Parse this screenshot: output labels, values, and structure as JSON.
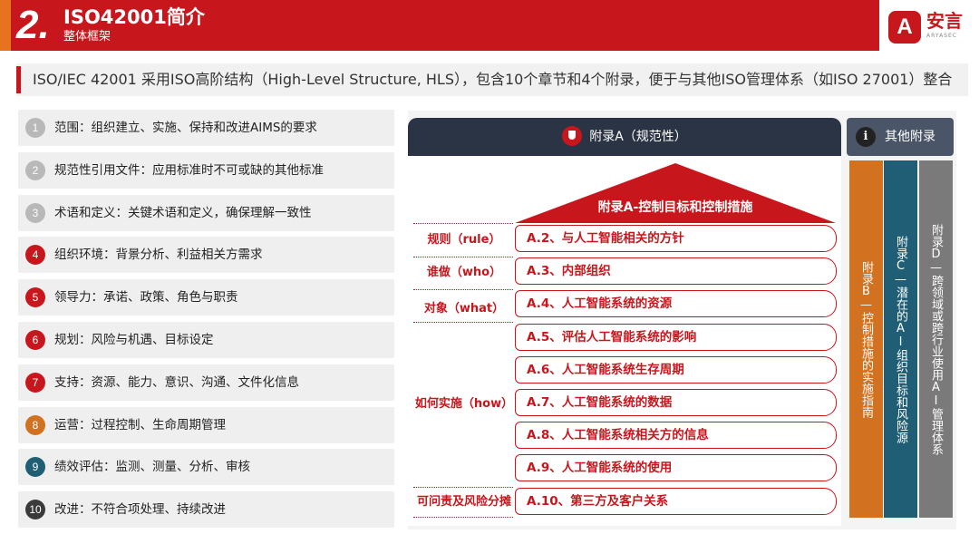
{
  "header": {
    "number": "2.",
    "title": "ISO42001简介",
    "subtitle": "整体框架"
  },
  "logo": {
    "mark": "A",
    "name": "安言",
    "en": "ARYASEC"
  },
  "intro": "ISO/IEC 42001 采用ISO高阶结构（High-Level Structure, HLS），包含10个章节和4个附录，便于与其他ISO管理体系（如ISO 27001）整合",
  "chapters": [
    {
      "num": "1",
      "label": "范围：组织建立、实施、保持和改进AIMS的要求",
      "color": "#b8b8b8"
    },
    {
      "num": "2",
      "label": "规范性引用文件：应用标准时不可或缺的其他标准",
      "color": "#b8b8b8"
    },
    {
      "num": "3",
      "label": "术语和定义：关键术语和定义，确保理解一致性",
      "color": "#b8b8b8"
    },
    {
      "num": "4",
      "label": "组织环境：背景分析、利益相关方需求",
      "color": "#c8161d"
    },
    {
      "num": "5",
      "label": "领导力：承诺、政策、角色与职责",
      "color": "#c8161d"
    },
    {
      "num": "6",
      "label": "规划：风险与机遇、目标设定",
      "color": "#c8161d"
    },
    {
      "num": "7",
      "label": "支持：资源、能力、意识、沟通、文件化信息",
      "color": "#c8161d"
    },
    {
      "num": "8",
      "label": "运营：过程控制、生命周期管理",
      "color": "#d2711f"
    },
    {
      "num": "9",
      "label": "绩效评估：监测、测量、分析、审核",
      "color": "#1f5e74"
    },
    {
      "num": "10",
      "label": "改进：不符合项处理、持续改进",
      "color": "#3a3a3a"
    }
  ],
  "annexA": {
    "header": "附录A（规范性）",
    "roof": "附录A-控制目标和控制措施",
    "categories": [
      {
        "label": "规则（rule）"
      },
      {
        "label": "谁做（who）"
      },
      {
        "label": "对象（what）"
      },
      {
        "label": "如何实施（how）"
      },
      {
        "label": "可问责及风险分摊"
      }
    ],
    "controls": [
      "A.2、与人工智能相关的方针",
      "A.3、内部组织",
      "A.4、人工智能系统的资源",
      "A.5、评估人工智能系统的影响",
      "A.6、人工智能系统生存周期",
      "A.7、人工智能系统的数据",
      "A.8、人工智能系统相关方的信息",
      "A.9、人工智能系统的使用",
      "A.10、第三方及客户关系"
    ]
  },
  "other": {
    "header": "其他附录",
    "icon_glyph": "i",
    "annexB": "附录B—控制措施的实施指南",
    "annexC": "附录C—潜在的AI组织目标和风险源",
    "annexD": "附录D—跨领域或跨行业使用AI管理体系",
    "colors": {
      "annexB": "#d2711f",
      "annexC": "#1f5e74",
      "annexD": "#7a7a7a"
    }
  }
}
